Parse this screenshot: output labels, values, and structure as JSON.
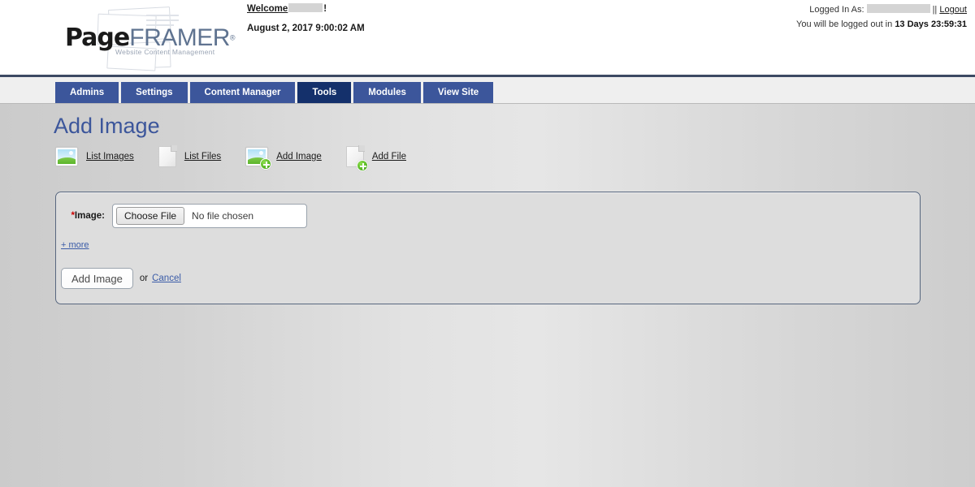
{
  "brand": {
    "name_bold": "Page",
    "name_light": "FRAMER",
    "registered": "®",
    "tagline": "Website Content Management"
  },
  "header": {
    "welcome_label": "Welcome",
    "welcome_suffix": "!",
    "welcome_user_redacted": true,
    "datetime": "August 2, 2017 9:00:02 AM",
    "logged_in_as_label": "Logged In As:",
    "logged_in_user_redacted": true,
    "separator": "||",
    "logout_label": "Logout",
    "logout_notice_prefix": "You will be logged out in",
    "logout_timer": "13 Days 23:59:31"
  },
  "nav": {
    "tabs": [
      {
        "label": "Admins",
        "active": false
      },
      {
        "label": "Settings",
        "active": false
      },
      {
        "label": "Content Manager",
        "active": false
      },
      {
        "label": "Tools",
        "active": true
      },
      {
        "label": "Modules",
        "active": false
      },
      {
        "label": "View Site",
        "active": false
      }
    ]
  },
  "page": {
    "title": "Add Image"
  },
  "toolbar": {
    "items": [
      {
        "label": "List Images",
        "icon": "image-icon"
      },
      {
        "label": "List Files",
        "icon": "file-icon"
      },
      {
        "label": "Add Image",
        "icon": "image-add-icon"
      },
      {
        "label": "Add File",
        "icon": "file-add-icon"
      }
    ]
  },
  "form": {
    "required_marker": "*",
    "image_label": "Image:",
    "choose_file_button": "Choose File",
    "file_status": "No file chosen",
    "more_link": "+ more",
    "submit_button": "Add Image",
    "or_text": "or",
    "cancel_link": "Cancel"
  },
  "colors": {
    "nav_tab": "#3c569b",
    "nav_tab_active": "#14306b",
    "title": "#3c569b",
    "link": "#3b5ca8",
    "required": "#cc0000",
    "panel_border": "#58677f",
    "plus_badge": "#5cbb28",
    "header_rule": "#3c4a63"
  }
}
